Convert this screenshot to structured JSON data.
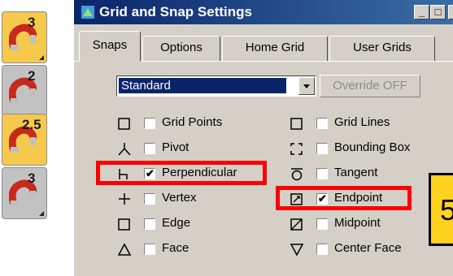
{
  "snap_toggles": [
    {
      "label": "3",
      "state": "active",
      "icon": "magnet-icon"
    },
    {
      "label": "2",
      "state": "inactive",
      "icon": "magnet-icon"
    },
    {
      "label": "2.5",
      "state": "active",
      "icon": "magnet-icon"
    },
    {
      "label": "3",
      "state": "inactive",
      "icon": "magnet-icon"
    }
  ],
  "dialog": {
    "title": "Grid and Snap Settings",
    "window_buttons": [
      "_",
      "□",
      "×"
    ],
    "tabs": [
      "Snaps",
      "Options",
      "Home Grid",
      "User Grids"
    ],
    "selected_tab": "Snaps",
    "set_dropdown": {
      "value": "Standard"
    },
    "override_button": "Override OFF",
    "snaps_left": [
      {
        "label": "Grid Points",
        "checked": false,
        "icon": "grid-points-icon"
      },
      {
        "label": "Pivot",
        "checked": false,
        "icon": "pivot-icon"
      },
      {
        "label": "Perpendicular",
        "checked": true,
        "icon": "perpendicular-icon"
      },
      {
        "label": "Vertex",
        "checked": false,
        "icon": "vertex-icon"
      },
      {
        "label": "Edge",
        "checked": false,
        "icon": "edge-icon"
      },
      {
        "label": "Face",
        "checked": false,
        "icon": "face-icon"
      }
    ],
    "snaps_right": [
      {
        "label": "Grid Lines",
        "checked": false,
        "icon": "grid-lines-icon"
      },
      {
        "label": "Bounding Box",
        "checked": false,
        "icon": "bounding-box-icon"
      },
      {
        "label": "Tangent",
        "checked": false,
        "icon": "tangent-icon"
      },
      {
        "label": "Endpoint",
        "checked": true,
        "icon": "endpoint-icon"
      },
      {
        "label": "Midpoint",
        "checked": false,
        "icon": "midpoint-icon"
      },
      {
        "label": "Center Face",
        "checked": false,
        "icon": "center-face-icon"
      }
    ]
  },
  "callout": {
    "text": "5"
  },
  "colors": {
    "highlight": "#ff0000",
    "callout_bg": "#ffd21f",
    "title_bar": "#0a246a",
    "active_toggle": "#f6c94d"
  }
}
